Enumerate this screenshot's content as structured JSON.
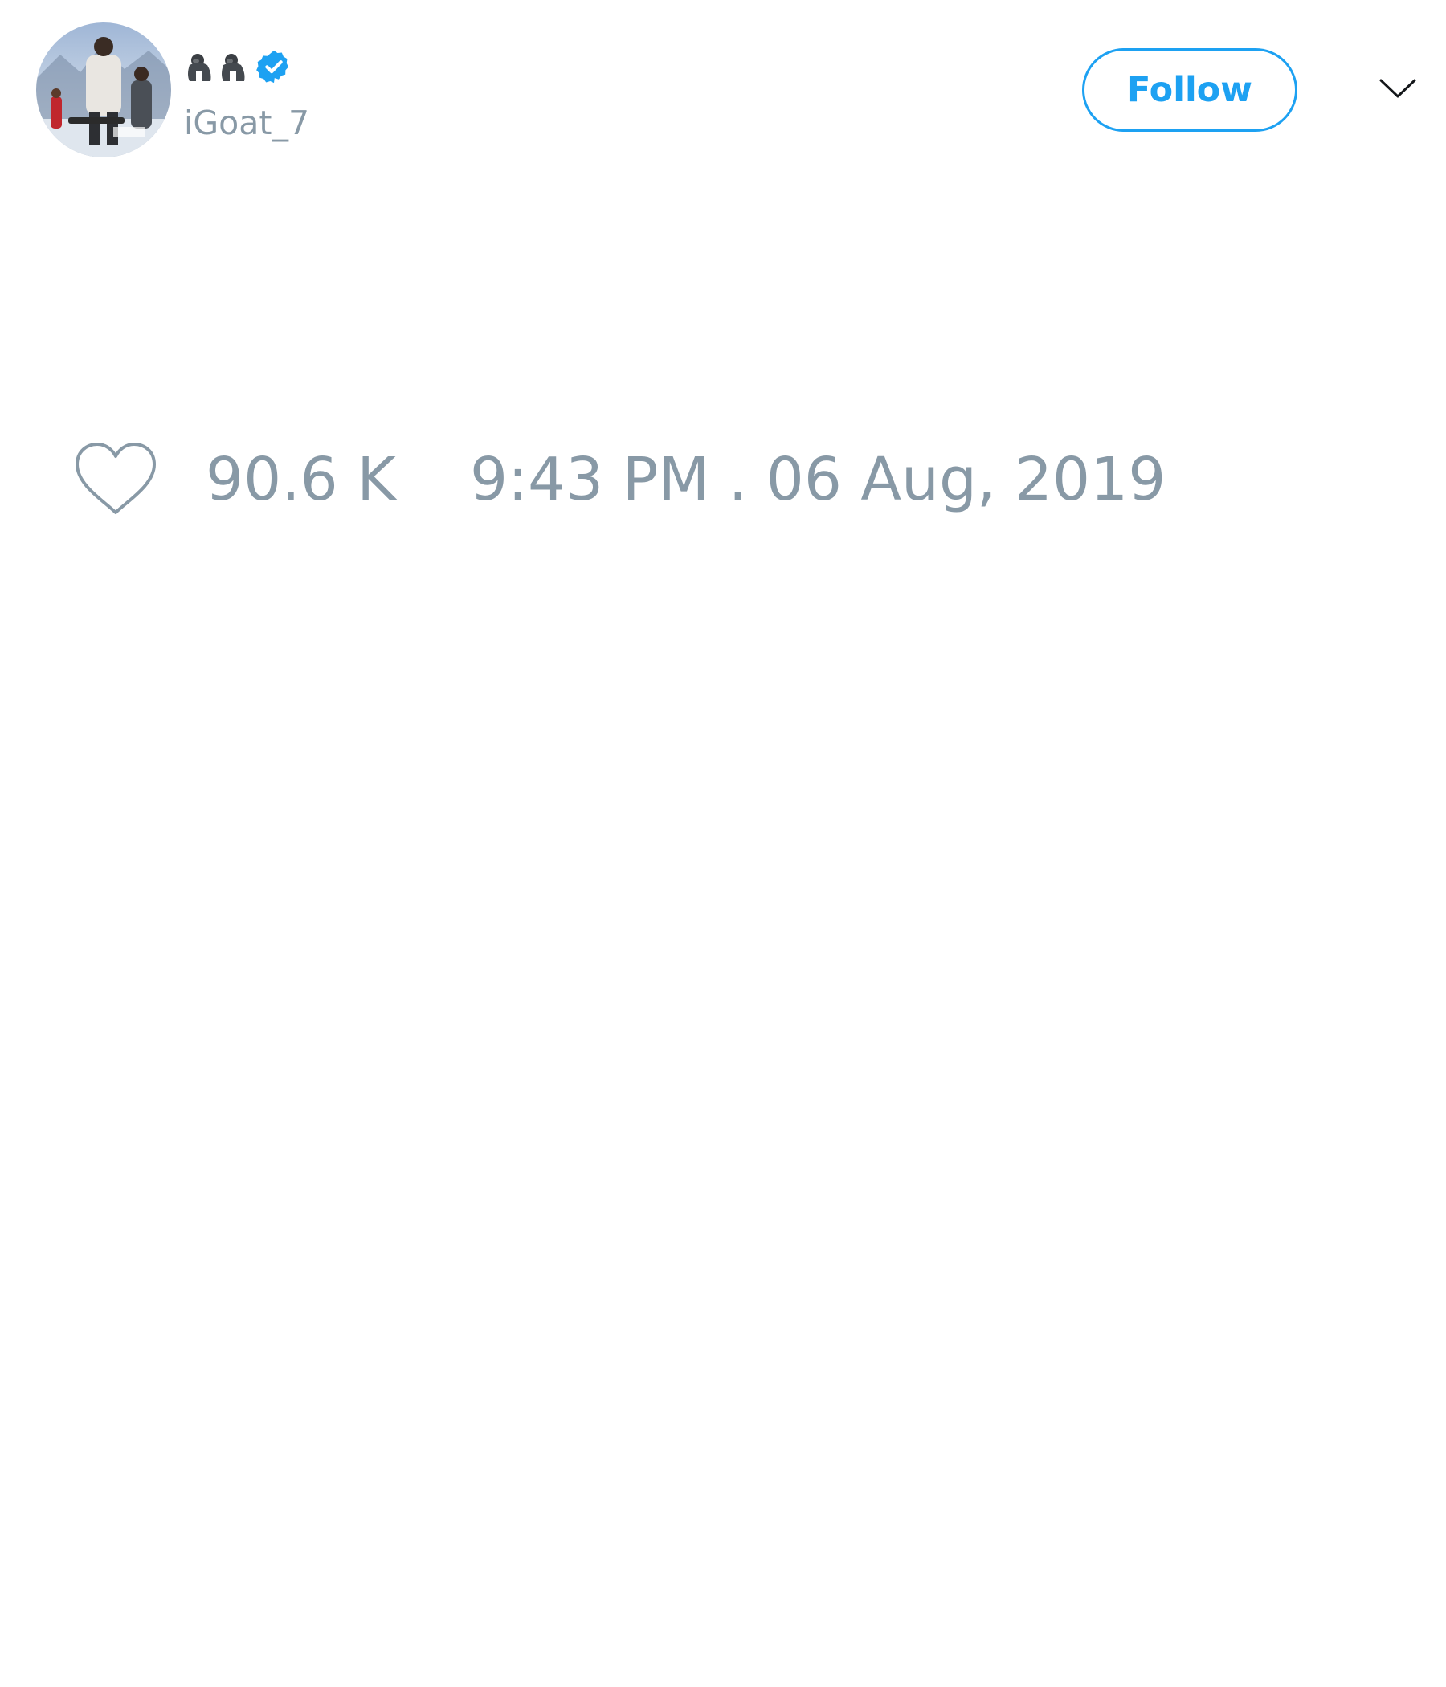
{
  "tweet": {
    "author": {
      "display_name_icons": [
        "gorilla-icon",
        "gorilla-icon"
      ],
      "verified": true,
      "handle": "iGoat_7"
    },
    "follow_label": "Follow",
    "more_icon": "chevron-down-icon",
    "likes": {
      "icon": "heart-outline-icon",
      "count": "90.6 K"
    },
    "timestamp": "9:43 PM . 06 Aug, 2019"
  },
  "colors": {
    "accent": "#1da1f2",
    "muted_text": "#8899a6",
    "text": "#14171a",
    "background": "#ffffff"
  }
}
